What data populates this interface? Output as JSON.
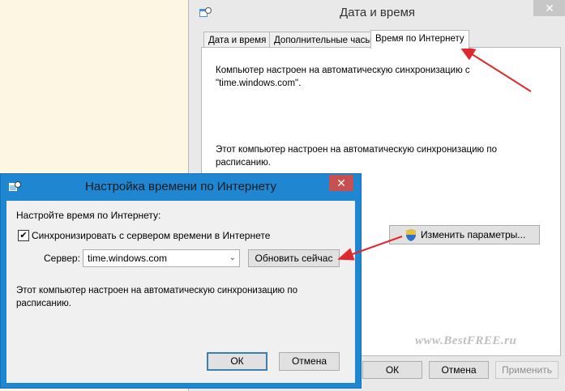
{
  "main_window": {
    "title": "Дата и время",
    "close_glyph": "✕",
    "tabs": [
      {
        "label": "Дата и время",
        "active": false
      },
      {
        "label": "Дополнительные часы",
        "active": false
      },
      {
        "label": "Время по Интернету",
        "active": true
      }
    ],
    "panel": {
      "status_line1": "Компьютер настроен на автоматическую синхронизацию с",
      "status_line2": "\"time.windows.com\".",
      "schedule_line1": "Этот компьютер настроен на автоматическую синхронизацию по",
      "schedule_line2": "расписанию.",
      "change_settings_label": "Изменить параметры..."
    },
    "buttons": {
      "ok": "ОК",
      "cancel": "Отмена",
      "apply": "Применить"
    }
  },
  "dialog": {
    "title": "Настройка времени по Интернету",
    "close_glyph": "✕",
    "prompt": "Настройте время по Интернету:",
    "sync_checkbox_label": "Синхронизировать с сервером времени в Интернете",
    "sync_checked": true,
    "server_label": "Сервер:",
    "server_value": "time.windows.com",
    "update_now_label": "Обновить сейчас",
    "schedule_line1": "Этот компьютер настроен на автоматическую синхронизацию по",
    "schedule_line2": "расписанию.",
    "ok_label": "ОК",
    "cancel_label": "Отмена"
  },
  "watermark": "www.BestFREE.ru",
  "colors": {
    "arrow": "#e0282e",
    "accent": "#1f86d1",
    "background": "#fdf6e3"
  }
}
